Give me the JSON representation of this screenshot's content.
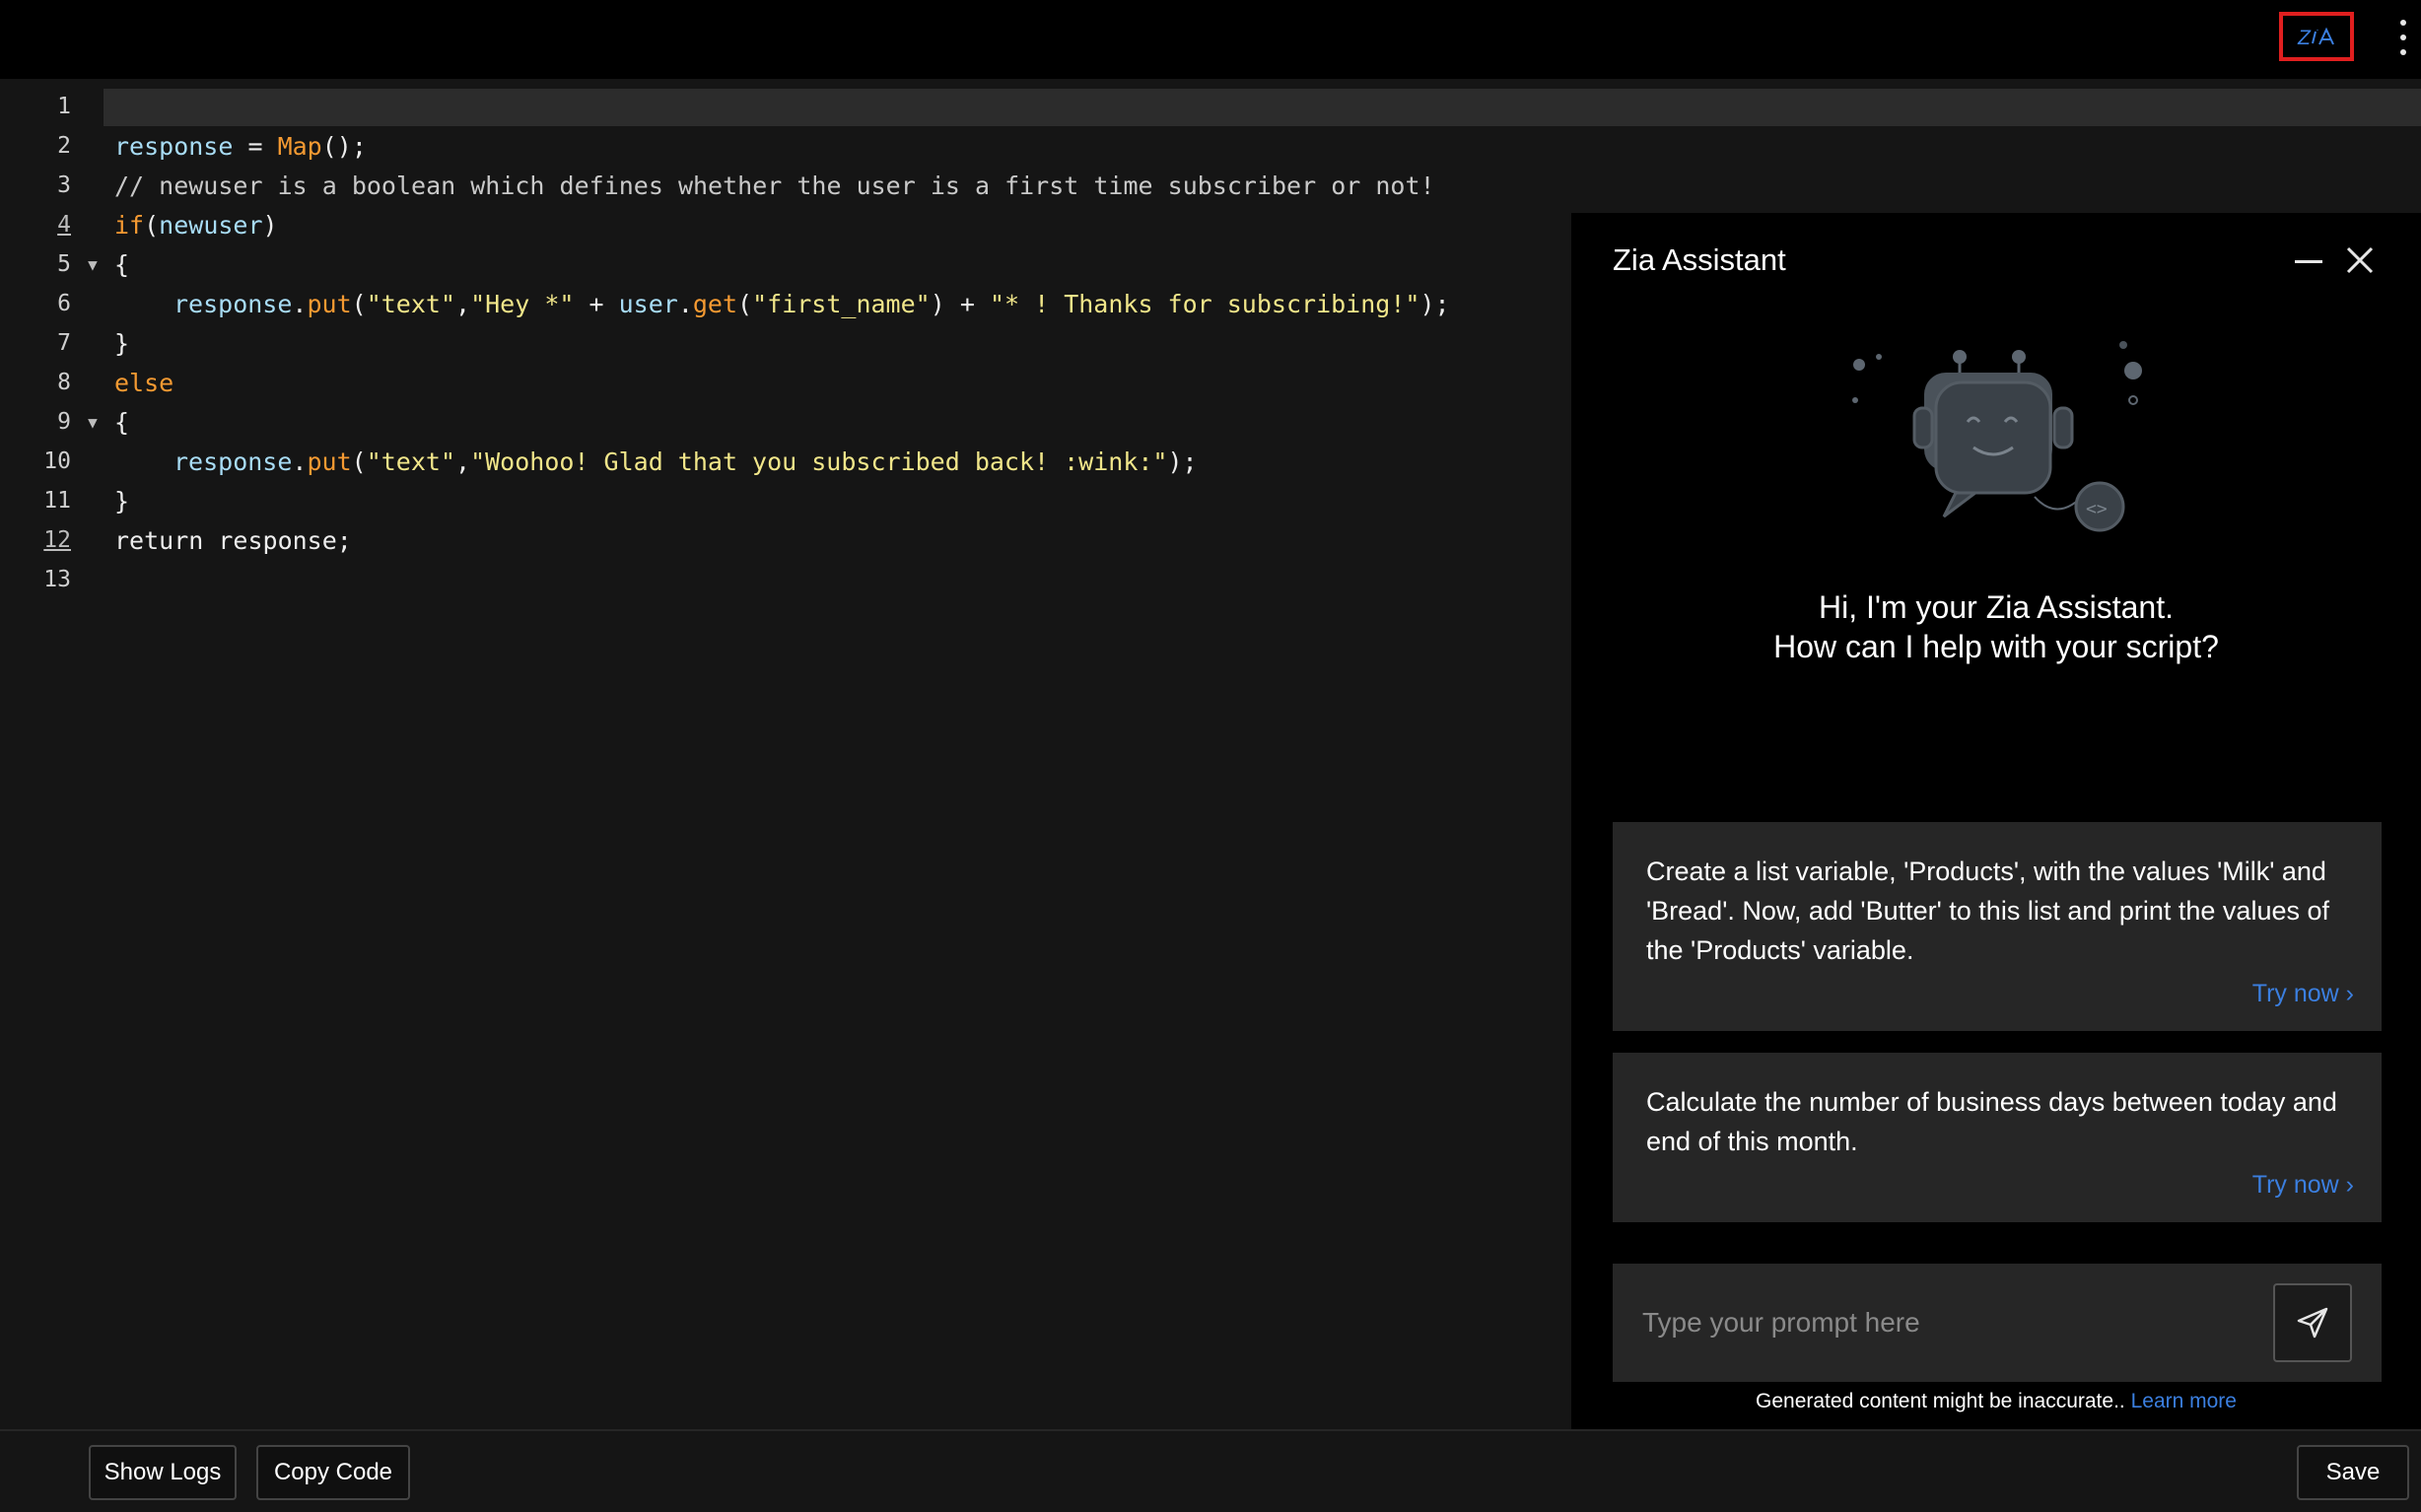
{
  "header": {
    "zia_icon": "zia-logo-icon",
    "more_icon": "more-vertical-icon"
  },
  "editor": {
    "lines": [
      {
        "n": "1",
        "u": false
      },
      {
        "n": "2",
        "u": false
      },
      {
        "n": "3",
        "u": false
      },
      {
        "n": "4",
        "u": true
      },
      {
        "n": "5",
        "u": false
      },
      {
        "n": "6",
        "u": false
      },
      {
        "n": "7",
        "u": false
      },
      {
        "n": "8",
        "u": false
      },
      {
        "n": "9",
        "u": false
      },
      {
        "n": "10",
        "u": false
      },
      {
        "n": "11",
        "u": false
      },
      {
        "n": "12",
        "u": true
      },
      {
        "n": "13",
        "u": false
      }
    ],
    "code": {
      "l2_var": "response",
      "l2_eq": " = ",
      "l2_fn": "Map",
      "l2_end": "();",
      "l3": "// newuser is a boolean which defines whether the user is a first time subscriber or not!",
      "l4_kw": "if",
      "l4_open": "(",
      "l4_var": "newuser",
      "l4_close": ")",
      "brace_open": "{",
      "brace_close": "}",
      "l6_var": "response",
      "l6_dot": ".",
      "l6_fn": "put",
      "l6_p1": "(",
      "l6_s1": "\"text\"",
      "l6_c": ",",
      "l6_s2": "\"Hey *\"",
      "l6_plus1": " + ",
      "l6_var2": "user",
      "l6_dot2": ".",
      "l6_fn2": "get",
      "l6_p2": "(",
      "l6_s3": "\"first_name\"",
      "l6_p3": ")",
      "l6_plus2": " + ",
      "l6_s4": "\"* ! Thanks for subscribing!\"",
      "l6_end": ");",
      "l8_kw": "else",
      "l10_var": "response",
      "l10_dot": ".",
      "l10_fn": "put",
      "l10_p1": "(",
      "l10_s1": "\"text\"",
      "l10_c": ",",
      "l10_s2": "\"Woohoo! Glad that you subscribed back! :wink:\"",
      "l10_end": ");",
      "l12": "return response;"
    }
  },
  "zia": {
    "title": "Zia Assistant",
    "greeting_line1": "Hi, I'm your Zia Assistant.",
    "greeting_line2": "How can I help with your script?",
    "suggestions": [
      {
        "text": "Create a list variable, 'Products', with the values 'Milk' and 'Bread'. Now, add 'Butter' to this list and print the values of the 'Products' variable.",
        "action": "Try now"
      },
      {
        "text": "Calculate the number of business days between today and end of this month.",
        "action": "Try now"
      }
    ],
    "prompt_placeholder": "Type your prompt here",
    "disclaimer": "Generated content might be inaccurate..",
    "learn_more": "Learn more"
  },
  "footer": {
    "show_logs": "Show Logs",
    "copy_code": "Copy Code",
    "save": "Save"
  },
  "colors": {
    "accent_link": "#3b7fe0",
    "highlight_border": "#e01f1f",
    "keyword": "#f59a32",
    "string": "#f1e68a",
    "variable": "#a8dcf5"
  }
}
